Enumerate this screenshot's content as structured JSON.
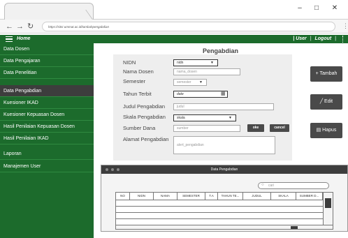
{
  "browser": {
    "url": "https://sitsi-ummat.ac.id/tambahpengabdian",
    "buttons": {
      "back": "←",
      "forward": "→",
      "reload": "↻",
      "minimize": "–",
      "maximize": "□",
      "close": "✕",
      "menu": "⋮"
    }
  },
  "header": {
    "home_label": "Home",
    "user_label": "User",
    "logout_label": "Logout",
    "separator": "|",
    "menu_icon": "hamburger-icon"
  },
  "sidebar": {
    "items": [
      {
        "label": "Data Dosen"
      },
      {
        "label": "Data Pengajaran"
      },
      {
        "label": "Data Penelitian"
      },
      {
        "label": "Data Pengabdian"
      },
      {
        "label": "Kuesioner IKAD"
      },
      {
        "label": "Kuesioner  Kepuasan Dosen"
      },
      {
        "label": "Hasil Penilaian Kepuasan Dosen"
      },
      {
        "label": "Hasil Penilaian IKAD"
      },
      {
        "label": "Laporan"
      },
      {
        "label": "Manajemen User"
      }
    ],
    "active_index": 3
  },
  "page": {
    "title": "Pengabdian"
  },
  "form": {
    "nidn": {
      "label": "NIDN",
      "value": "nidn"
    },
    "nama_dosen": {
      "label": "Nama Dosen",
      "placeholder": "nama_dosen"
    },
    "semester": {
      "label": "Semester",
      "value": "semester"
    },
    "tahun_terbit": {
      "label": "Tahun Terbit",
      "value": "date",
      "icon": "calendar-icon",
      "icon_glyph": "▦"
    },
    "judul": {
      "label": "Judul Pengabdian",
      "placeholder": "judul"
    },
    "skala": {
      "label": "Skala Pengabdian",
      "value": "skala"
    },
    "sumber_dana": {
      "label": "Sumber Dana",
      "placeholder": "sumber"
    },
    "alamat": {
      "label": "Alamat Pengabdian",
      "placeholder": "alert_pengabdian"
    },
    "oke_label": "oke",
    "cancel_label": "cancel"
  },
  "actions": {
    "tambah": "+ Tambah",
    "edit": "╱ Edit",
    "hapus": "▤ Hapus"
  },
  "table_window": {
    "title": "Data Pengabdian",
    "search_placeholder": "cari",
    "search_icon": "○",
    "columns": [
      "NO",
      "NIDN",
      "NAMA",
      "SEMESTER",
      "T.A",
      "TAHUN TE...",
      "JUDUL",
      "SKALA",
      "SUMBER D..."
    ],
    "rows": 4
  },
  "colors": {
    "primary": "#1c6b2c",
    "dark": "#3d3d3d",
    "panel": "#eeeeee"
  }
}
